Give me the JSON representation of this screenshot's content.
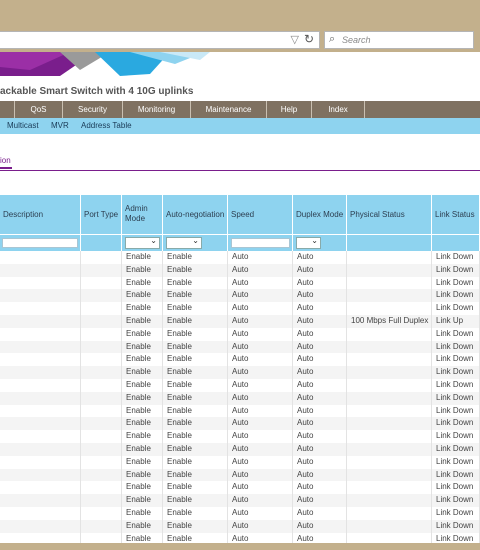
{
  "browser": {
    "search_placeholder": "Search",
    "dropdown_glyph": "▽",
    "reload_glyph": "↻",
    "search_glyph": "⌕"
  },
  "page_title": "ackable Smart Switch with 4 10G uplinks",
  "main_nav": [
    "QoS",
    "Security",
    "Monitoring",
    "Maintenance",
    "Help",
    "Index"
  ],
  "sub_nav": [
    "Multicast",
    "MVR",
    "Address Table"
  ],
  "tab_label": "ion",
  "colors": {
    "frame": "#c3b08c",
    "nav_bg": "#7f7161",
    "subnav_bg": "#8ed3ef",
    "table_header_bg": "#8ed3ef",
    "accent_purple": "#7a1e8c"
  },
  "table": {
    "headers": {
      "description": "Description",
      "port_type": "Port Type",
      "admin_mode": "Admin Mode",
      "auto_negotiation": "Auto-negotiation",
      "speed": "Speed",
      "duplex_mode": "Duplex Mode",
      "physical_status": "Physical Status",
      "link_status": "Link Status"
    },
    "rows": [
      {
        "admin": "Enable",
        "auto": "Enable",
        "speed": "Auto",
        "duplex": "Auto",
        "phys": "",
        "link": "Link Down"
      },
      {
        "admin": "Enable",
        "auto": "Enable",
        "speed": "Auto",
        "duplex": "Auto",
        "phys": "",
        "link": "Link Down"
      },
      {
        "admin": "Enable",
        "auto": "Enable",
        "speed": "Auto",
        "duplex": "Auto",
        "phys": "",
        "link": "Link Down"
      },
      {
        "admin": "Enable",
        "auto": "Enable",
        "speed": "Auto",
        "duplex": "Auto",
        "phys": "",
        "link": "Link Down"
      },
      {
        "admin": "Enable",
        "auto": "Enable",
        "speed": "Auto",
        "duplex": "Auto",
        "phys": "",
        "link": "Link Down"
      },
      {
        "admin": "Enable",
        "auto": "Enable",
        "speed": "Auto",
        "duplex": "Auto",
        "phys": "100 Mbps Full Duplex",
        "link": "Link Up"
      },
      {
        "admin": "Enable",
        "auto": "Enable",
        "speed": "Auto",
        "duplex": "Auto",
        "phys": "",
        "link": "Link Down"
      },
      {
        "admin": "Enable",
        "auto": "Enable",
        "speed": "Auto",
        "duplex": "Auto",
        "phys": "",
        "link": "Link Down"
      },
      {
        "admin": "Enable",
        "auto": "Enable",
        "speed": "Auto",
        "duplex": "Auto",
        "phys": "",
        "link": "Link Down"
      },
      {
        "admin": "Enable",
        "auto": "Enable",
        "speed": "Auto",
        "duplex": "Auto",
        "phys": "",
        "link": "Link Down"
      },
      {
        "admin": "Enable",
        "auto": "Enable",
        "speed": "Auto",
        "duplex": "Auto",
        "phys": "",
        "link": "Link Down"
      },
      {
        "admin": "Enable",
        "auto": "Enable",
        "speed": "Auto",
        "duplex": "Auto",
        "phys": "",
        "link": "Link Down"
      },
      {
        "admin": "Enable",
        "auto": "Enable",
        "speed": "Auto",
        "duplex": "Auto",
        "phys": "",
        "link": "Link Down"
      },
      {
        "admin": "Enable",
        "auto": "Enable",
        "speed": "Auto",
        "duplex": "Auto",
        "phys": "",
        "link": "Link Down"
      },
      {
        "admin": "Enable",
        "auto": "Enable",
        "speed": "Auto",
        "duplex": "Auto",
        "phys": "",
        "link": "Link Down"
      },
      {
        "admin": "Enable",
        "auto": "Enable",
        "speed": "Auto",
        "duplex": "Auto",
        "phys": "",
        "link": "Link Down"
      },
      {
        "admin": "Enable",
        "auto": "Enable",
        "speed": "Auto",
        "duplex": "Auto",
        "phys": "",
        "link": "Link Down"
      },
      {
        "admin": "Enable",
        "auto": "Enable",
        "speed": "Auto",
        "duplex": "Auto",
        "phys": "",
        "link": "Link Down"
      },
      {
        "admin": "Enable",
        "auto": "Enable",
        "speed": "Auto",
        "duplex": "Auto",
        "phys": "",
        "link": "Link Down"
      },
      {
        "admin": "Enable",
        "auto": "Enable",
        "speed": "Auto",
        "duplex": "Auto",
        "phys": "",
        "link": "Link Down"
      },
      {
        "admin": "Enable",
        "auto": "Enable",
        "speed": "Auto",
        "duplex": "Auto",
        "phys": "",
        "link": "Link Down"
      },
      {
        "admin": "Enable",
        "auto": "Enable",
        "speed": "Auto",
        "duplex": "Auto",
        "phys": "",
        "link": "Link Down"
      },
      {
        "admin": "Enable",
        "auto": "Enable",
        "speed": "Auto",
        "duplex": "Auto",
        "phys": "",
        "link": "Link Down"
      }
    ]
  }
}
